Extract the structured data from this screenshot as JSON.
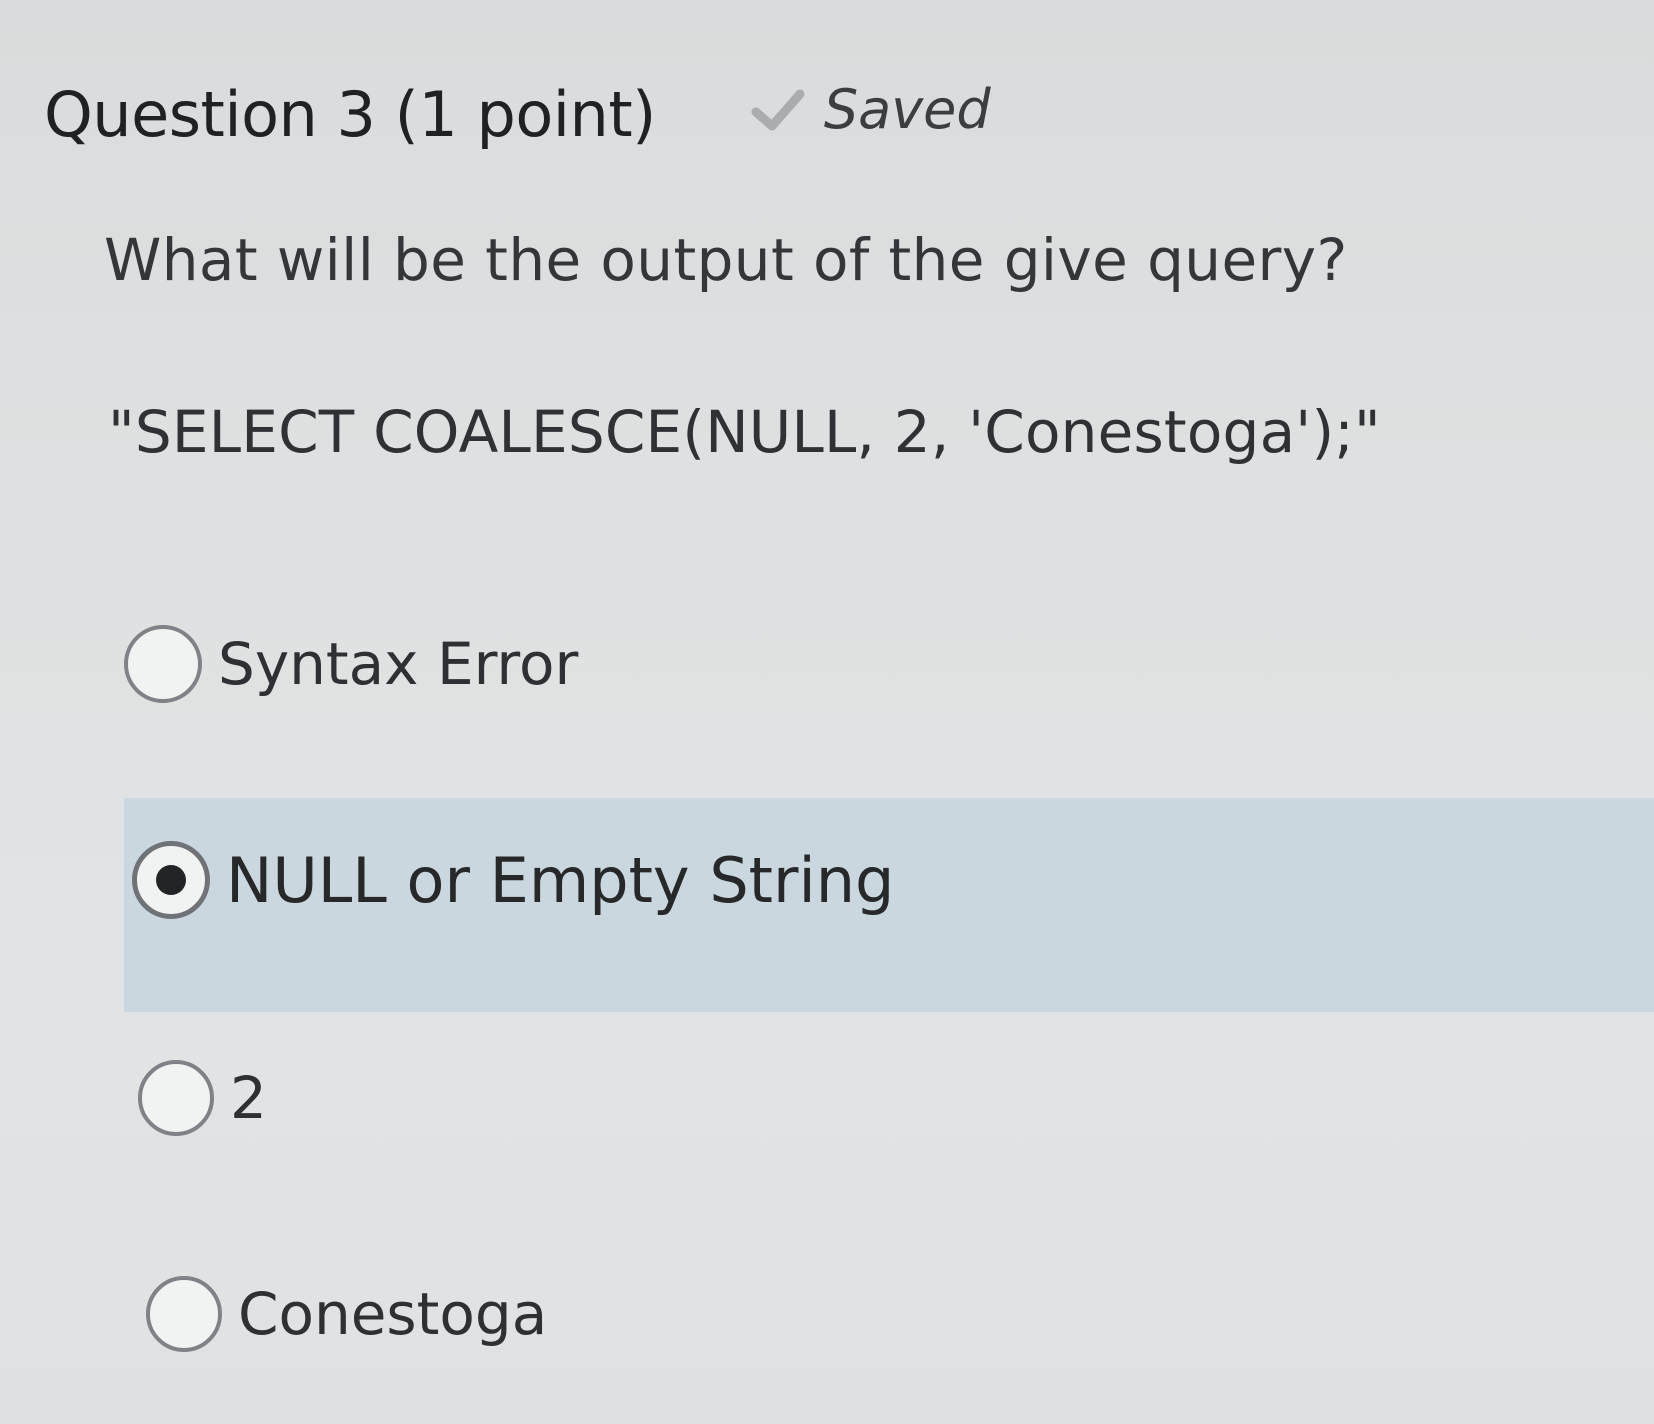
{
  "question": {
    "title": "Question 3 (1 point)",
    "status_label": "Saved",
    "status_icon": "checkmark-icon",
    "prompt": "What will be the output of the give query?",
    "query": "\"SELECT COALESCE(NULL, 2, 'Conestoga');\""
  },
  "options": [
    {
      "label": "Syntax Error",
      "selected": false
    },
    {
      "label": "NULL or Empty String",
      "selected": true
    },
    {
      "label": "2",
      "selected": false
    },
    {
      "label": "Conestoga",
      "selected": false
    }
  ],
  "colors": {
    "page_background": "#dfe2e2",
    "selected_highlight": "#cbd7de",
    "check_icon": "#a9adb0",
    "radio_border": "#7f8286",
    "radio_dot": "#222426"
  }
}
